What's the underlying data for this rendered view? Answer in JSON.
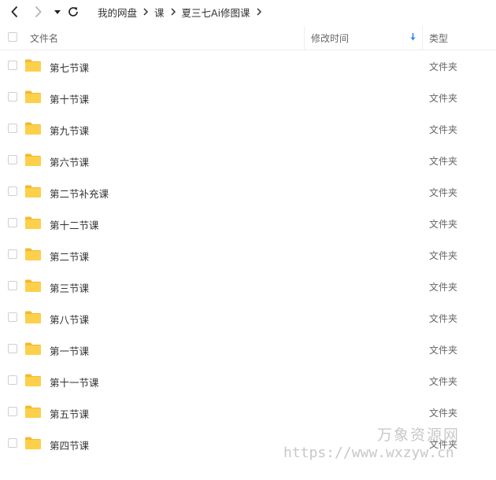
{
  "toolbar": {
    "back_icon": "chevron-left-icon",
    "forward_icon": "chevron-right-icon",
    "history_icon": "caret-down-icon",
    "refresh_icon": "refresh-icon"
  },
  "breadcrumb": [
    "我的网盘",
    "课",
    "夏三七Ai修图课"
  ],
  "header": {
    "name": "文件名",
    "modified": "修改时间",
    "type": "类型"
  },
  "files": [
    {
      "name": "第七节课",
      "type": "文件夹"
    },
    {
      "name": "第十节课",
      "type": "文件夹"
    },
    {
      "name": "第九节课",
      "type": "文件夹"
    },
    {
      "name": "第六节课",
      "type": "文件夹"
    },
    {
      "name": "第二节补充课",
      "type": "文件夹"
    },
    {
      "name": "第十二节课",
      "type": "文件夹"
    },
    {
      "name": "第二节课",
      "type": "文件夹"
    },
    {
      "name": "第三节课",
      "type": "文件夹"
    },
    {
      "name": "第八节课",
      "type": "文件夹"
    },
    {
      "name": "第一节课",
      "type": "文件夹"
    },
    {
      "name": "第十一节课",
      "type": "文件夹"
    },
    {
      "name": "第五节课",
      "type": "文件夹"
    },
    {
      "name": "第四节课",
      "type": "文件夹"
    }
  ],
  "watermark": {
    "brand": "万象资源网",
    "url": "https://www.wxzyw.cn"
  },
  "colors": {
    "folder": "#fcd04a",
    "folder_tab": "#f5b82e",
    "sort_arrow": "#2a8ce8",
    "divider": "#eeeeee"
  }
}
